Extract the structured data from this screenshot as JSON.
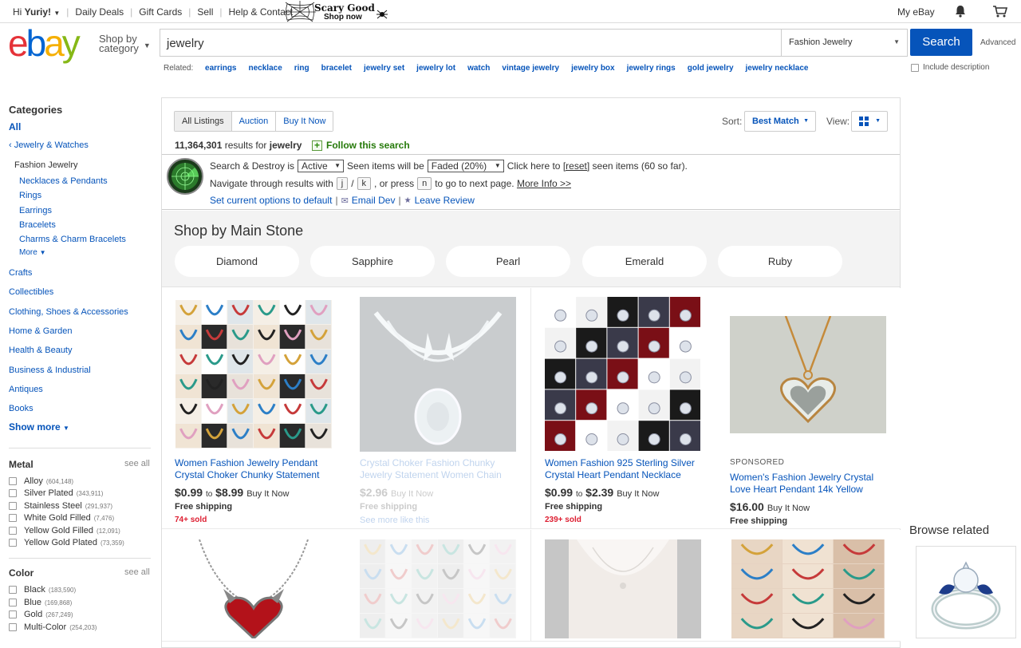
{
  "topbar": {
    "greeting_prefix": "Hi ",
    "user": "Yuriy!",
    "links": [
      "Daily Deals",
      "Gift Cards",
      "Sell",
      "Help & Contact"
    ],
    "promo_line1": "Scary Good",
    "promo_line2": "Shop now",
    "my_ebay": "My eBay"
  },
  "header": {
    "logo": [
      "e",
      "b",
      "a",
      "y"
    ],
    "shop_by_1": "Shop by",
    "shop_by_2": "category",
    "search_value": "jewelry",
    "category": "Fashion Jewelry",
    "search_button": "Search",
    "advanced": "Advanced",
    "include_description": "Include description",
    "related_label": "Related:",
    "related": [
      "earrings",
      "necklace",
      "ring",
      "bracelet",
      "jewelry set",
      "jewelry lot",
      "watch",
      "vintage jewelry",
      "jewelry box",
      "jewelry rings",
      "gold jewelry",
      "jewelry necklace"
    ]
  },
  "sidebar": {
    "categories_title": "Categories",
    "all": "All",
    "parent": "Jewelry & Watches",
    "current": "Fashion Jewelry",
    "subcats": [
      "Necklaces & Pendants",
      "Rings",
      "Earrings",
      "Bracelets",
      "Charms & Charm Bracelets"
    ],
    "more": "More",
    "cats": [
      "Crafts",
      "Collectibles",
      "Clothing, Shoes & Accessories",
      "Home & Garden",
      "Health & Beauty",
      "Business & Industrial",
      "Antiques",
      "Books"
    ],
    "show_more": "Show more",
    "metal_title": "Metal",
    "see_all": "see all",
    "metal": [
      {
        "label": "Alloy",
        "count": "(604,148)"
      },
      {
        "label": "Silver Plated",
        "count": "(343,911)"
      },
      {
        "label": "Stainless Steel",
        "count": "(291,937)"
      },
      {
        "label": "White Gold Filled",
        "count": "(7,476)"
      },
      {
        "label": "Yellow Gold Filled",
        "count": "(12,091)"
      },
      {
        "label": "Yellow Gold Plated",
        "count": "(73,359)"
      }
    ],
    "color_title": "Color",
    "color": [
      {
        "label": "Black",
        "count": "(183,590)"
      },
      {
        "label": "Blue",
        "count": "(169,868)"
      },
      {
        "label": "Gold",
        "count": "(267,249)"
      },
      {
        "label": "Multi-Color",
        "count": "(254,203)"
      }
    ]
  },
  "toolbar": {
    "tabs": [
      "All Listings",
      "Auction",
      "Buy It Now"
    ],
    "sort_label": "Sort:",
    "sort_value": "Best Match",
    "view_label": "View:",
    "results_count": "11,364,301",
    "results_for": "results for",
    "results_query": "jewelry",
    "follow": "Follow this search"
  },
  "search_destroy": {
    "l1_a": "Search & Destroy is",
    "l1_state": "Active",
    "l1_b": "Seen items will be",
    "l1_fade": "Faded (20%)",
    "l1_c": "Click here to",
    "l1_reset": "[reset]",
    "l1_d": "seen items (60 so far).",
    "l2_a": "Navigate through results with",
    "key_j": "j",
    "slash": "/",
    "key_k": "k",
    "l2_b": ", or press",
    "key_n": "n",
    "l2_c": "to go to next page.",
    "more_info": "More Info >>",
    "l3_default": "Set current options to default",
    "l3_email": "Email Dev",
    "l3_review": "Leave Review"
  },
  "stones": {
    "title": "Shop by Main Stone",
    "items": [
      "Diamond",
      "Sapphire",
      "Pearl",
      "Emerald",
      "Ruby"
    ]
  },
  "items": [
    {
      "title1": "Women Fashion Jewelry Pendant",
      "title2": "Crystal Choker Chunky Statement",
      "price_low": "$0.99",
      "to": "to",
      "price_high": "$8.99",
      "format": "Buy It Now",
      "shipping": "Free shipping",
      "sold": "74+ sold"
    },
    {
      "title1": "Crystal Choker Fashion Chunky",
      "title2": "Jewelry Statement Women Chain",
      "price": "$2.96",
      "format": "Buy It Now",
      "shipping": "Free shipping",
      "see_more": "See more like this"
    },
    {
      "title1": "Women Fashion 925 Sterling Silver",
      "title2": "Crystal Heart Pendant Necklace",
      "price_low": "$0.99",
      "to": "to",
      "price_high": "$2.39",
      "format": "Buy It Now",
      "shipping": "Free shipping",
      "sold": "239+ sold"
    },
    {
      "sponsored": "SPONSORED",
      "title1": "Women's Fashion Jewelry Crystal",
      "title2": "Love Heart Pendant 14k Yellow",
      "price": "$16.00",
      "format": "Buy It Now",
      "shipping": "Free shipping"
    }
  ],
  "browse_related": "Browse related",
  "colors": {
    "accent": "#0654ba",
    "sold": "#dd1e31",
    "follow": "#267a0a"
  }
}
